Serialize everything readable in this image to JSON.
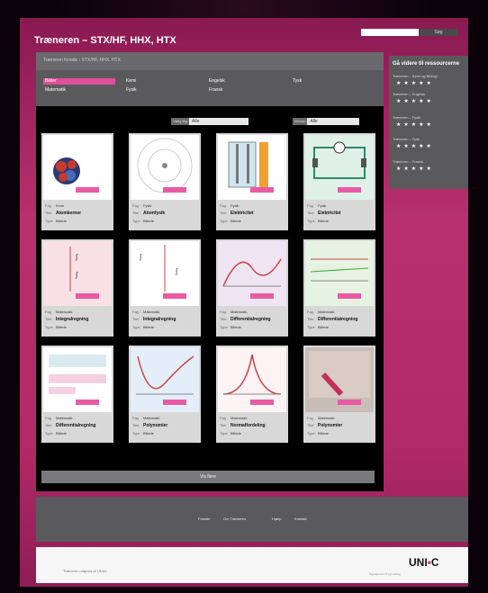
{
  "header": {
    "title": "Træneren – STX/HF, HHX, HTX",
    "search_button": "Søg"
  },
  "breadcrumb": "Træneren forside  ›  STX/HF, HHX, HTX",
  "tabs": [
    {
      "label": "Bilder"
    },
    {
      "label": "Kemi"
    },
    {
      "label": "Engelsk"
    },
    {
      "label": "Tysk"
    },
    {
      "label": "Matematik"
    },
    {
      "label": "Fysik"
    },
    {
      "label": "Fransk"
    }
  ],
  "filters": [
    {
      "label": "Vælg fag",
      "value": "Alle"
    },
    {
      "label": "Niveau",
      "value": "Alle"
    }
  ],
  "card_labels": {
    "fag": "Fag",
    "titel": "Titel",
    "type": "Type"
  },
  "cards": [
    {
      "fag": "Kemi",
      "titel": "Atomkerner",
      "type": "Billede",
      "thumb": "atom"
    },
    {
      "fag": "Fysik",
      "titel": "Atomfysik",
      "type": "Billede",
      "thumb": "circles"
    },
    {
      "fag": "Fysik",
      "titel": "Elektricitet",
      "type": "Billede",
      "thumb": "beakers"
    },
    {
      "fag": "Fysik",
      "titel": "Elektricitet",
      "type": "Billede",
      "thumb": "circuit"
    },
    {
      "fag": "Matematik",
      "titel": "Integralregning",
      "type": "Billede",
      "thumb": "math"
    },
    {
      "fag": "Matematik",
      "titel": "Integralregning",
      "type": "Billede",
      "thumb": "math2"
    },
    {
      "fag": "Matematik",
      "titel": "Differentialregning",
      "type": "Billede",
      "thumb": "graph"
    },
    {
      "fag": "Matematik",
      "titel": "Differentialregning",
      "type": "Billede",
      "thumb": "lines"
    },
    {
      "fag": "Matematik",
      "titel": "Differentialregning",
      "type": "Billede",
      "thumb": "grid"
    },
    {
      "fag": "Matematik",
      "titel": "Polynomier",
      "type": "Billede",
      "thumb": "parabola"
    },
    {
      "fag": "Matematik",
      "titel": "Normalfordeling",
      "type": "Billede",
      "thumb": "bell"
    },
    {
      "fag": "Matematik",
      "titel": "Polynomier",
      "type": "Billede",
      "thumb": "photo"
    }
  ],
  "more_button": "Vis flere",
  "sidebar": {
    "heading": "Gå videre til ressourcerne",
    "items": [
      {
        "label": "Træneren – Kemi og Biologi",
        "stars": "★★★★★"
      },
      {
        "label": "Træneren – Engelsk",
        "stars": "★★★★★"
      },
      {
        "label": "Træneren – Fysik",
        "stars": "★★★★★"
      },
      {
        "label": "Træneren – Tysk",
        "stars": "★★★★★"
      },
      {
        "label": "Træneren – Fransk",
        "stars": "★★★★★"
      }
    ]
  },
  "footer_nav": [
    "Forside",
    "Om Træneren",
    "Hjælp",
    "Kontakt"
  ],
  "copyright": "Træneren udgives af UNI•C",
  "logo": {
    "main": "UNI",
    "dot": "•",
    "end": "C"
  },
  "footer_sub": "Styrelsen for IT og Læring",
  "colors": {
    "accent": "#e0509a",
    "frame": "#b22a68",
    "panel": "#5a5a5c"
  }
}
